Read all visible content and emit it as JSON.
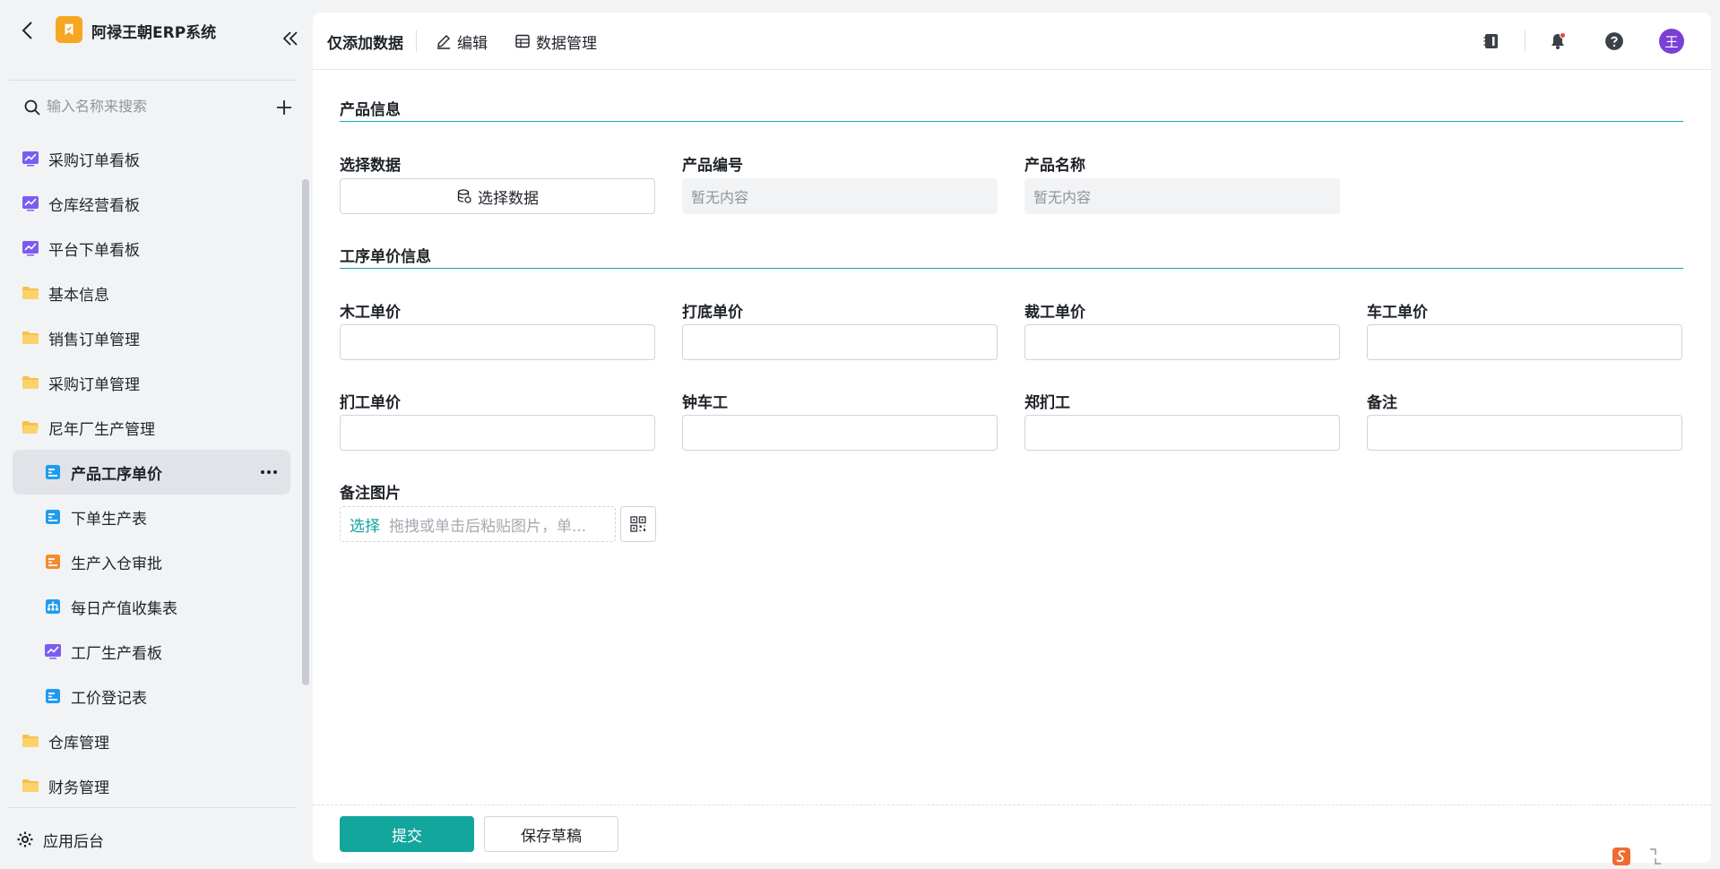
{
  "app": {
    "title": "阿禄王朝ERP系统",
    "brand_color": "#f5a623",
    "accent_color": "#12a69c"
  },
  "sidebar": {
    "search_placeholder": "输入名称来搜索",
    "items": [
      {
        "label": "采购订单看板",
        "icon": "dashboard-icon",
        "level": 0
      },
      {
        "label": "仓库经营看板",
        "icon": "dashboard-icon",
        "level": 0
      },
      {
        "label": "平台下单看板",
        "icon": "dashboard-icon",
        "level": 0
      },
      {
        "label": "基本信息",
        "icon": "folder-icon",
        "level": 0
      },
      {
        "label": "销售订单管理",
        "icon": "folder-icon",
        "level": 0
      },
      {
        "label": "采购订单管理",
        "icon": "folder-icon",
        "level": 0
      },
      {
        "label": "尼年厂生产管理",
        "icon": "folder-open-icon",
        "level": 0
      },
      {
        "label": "产品工序单价",
        "icon": "form-icon",
        "level": 1,
        "active": true
      },
      {
        "label": "下单生产表",
        "icon": "form-icon",
        "level": 1
      },
      {
        "label": "生产入仓审批",
        "icon": "approval-form-icon",
        "level": 1
      },
      {
        "label": "每日产值收集表",
        "icon": "collection-icon",
        "level": 1
      },
      {
        "label": "工厂生产看板",
        "icon": "dashboard-icon",
        "level": 1
      },
      {
        "label": "工价登记表",
        "icon": "form-icon",
        "level": 1
      },
      {
        "label": "仓库管理",
        "icon": "folder-icon",
        "level": 0
      },
      {
        "label": "财务管理",
        "icon": "folder-icon",
        "level": 0
      }
    ],
    "footer_label": "应用后台"
  },
  "toolbar": {
    "title": "仅添加数据",
    "edit_label": "编辑",
    "data_manage_label": "数据管理",
    "avatar_text": "王"
  },
  "form": {
    "section_product": "产品信息",
    "select_data_label": "选择数据",
    "select_data_button": "选择数据",
    "product_code_label": "产品编号",
    "product_code_value": "暂无内容",
    "product_name_label": "产品名称",
    "product_name_value": "暂无内容",
    "section_price": "工序单价信息",
    "fields": {
      "carpentry_price": "木工单价",
      "primer_price": "打底单价",
      "cutting_price": "裁工单价",
      "sewing_price": "车工单价",
      "button_price": "扪工单价",
      "zhong_sewing": "钟车工",
      "zheng_button": "郑扪工",
      "remark": "备注"
    },
    "remark_image_label": "备注图片",
    "upload_pick": "选择",
    "upload_hint": "拖拽或单击后粘贴图片，单..."
  },
  "footer": {
    "submit_label": "提交",
    "draft_label": "保存草稿"
  }
}
